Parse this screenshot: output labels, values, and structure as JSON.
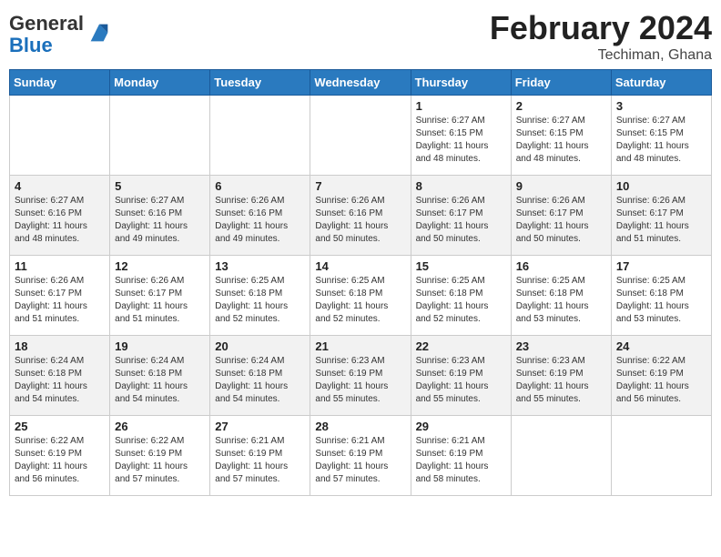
{
  "header": {
    "logo_general": "General",
    "logo_blue": "Blue",
    "title": "February 2024",
    "subtitle": "Techiman, Ghana"
  },
  "days_of_week": [
    "Sunday",
    "Monday",
    "Tuesday",
    "Wednesday",
    "Thursday",
    "Friday",
    "Saturday"
  ],
  "weeks": [
    [
      {
        "day": "",
        "info": ""
      },
      {
        "day": "",
        "info": ""
      },
      {
        "day": "",
        "info": ""
      },
      {
        "day": "",
        "info": ""
      },
      {
        "day": "1",
        "info": "Sunrise: 6:27 AM\nSunset: 6:15 PM\nDaylight: 11 hours and 48 minutes."
      },
      {
        "day": "2",
        "info": "Sunrise: 6:27 AM\nSunset: 6:15 PM\nDaylight: 11 hours and 48 minutes."
      },
      {
        "day": "3",
        "info": "Sunrise: 6:27 AM\nSunset: 6:15 PM\nDaylight: 11 hours and 48 minutes."
      }
    ],
    [
      {
        "day": "4",
        "info": "Sunrise: 6:27 AM\nSunset: 6:16 PM\nDaylight: 11 hours and 48 minutes."
      },
      {
        "day": "5",
        "info": "Sunrise: 6:27 AM\nSunset: 6:16 PM\nDaylight: 11 hours and 49 minutes."
      },
      {
        "day": "6",
        "info": "Sunrise: 6:26 AM\nSunset: 6:16 PM\nDaylight: 11 hours and 49 minutes."
      },
      {
        "day": "7",
        "info": "Sunrise: 6:26 AM\nSunset: 6:16 PM\nDaylight: 11 hours and 50 minutes."
      },
      {
        "day": "8",
        "info": "Sunrise: 6:26 AM\nSunset: 6:17 PM\nDaylight: 11 hours and 50 minutes."
      },
      {
        "day": "9",
        "info": "Sunrise: 6:26 AM\nSunset: 6:17 PM\nDaylight: 11 hours and 50 minutes."
      },
      {
        "day": "10",
        "info": "Sunrise: 6:26 AM\nSunset: 6:17 PM\nDaylight: 11 hours and 51 minutes."
      }
    ],
    [
      {
        "day": "11",
        "info": "Sunrise: 6:26 AM\nSunset: 6:17 PM\nDaylight: 11 hours and 51 minutes."
      },
      {
        "day": "12",
        "info": "Sunrise: 6:26 AM\nSunset: 6:17 PM\nDaylight: 11 hours and 51 minutes."
      },
      {
        "day": "13",
        "info": "Sunrise: 6:25 AM\nSunset: 6:18 PM\nDaylight: 11 hours and 52 minutes."
      },
      {
        "day": "14",
        "info": "Sunrise: 6:25 AM\nSunset: 6:18 PM\nDaylight: 11 hours and 52 minutes."
      },
      {
        "day": "15",
        "info": "Sunrise: 6:25 AM\nSunset: 6:18 PM\nDaylight: 11 hours and 52 minutes."
      },
      {
        "day": "16",
        "info": "Sunrise: 6:25 AM\nSunset: 6:18 PM\nDaylight: 11 hours and 53 minutes."
      },
      {
        "day": "17",
        "info": "Sunrise: 6:25 AM\nSunset: 6:18 PM\nDaylight: 11 hours and 53 minutes."
      }
    ],
    [
      {
        "day": "18",
        "info": "Sunrise: 6:24 AM\nSunset: 6:18 PM\nDaylight: 11 hours and 54 minutes."
      },
      {
        "day": "19",
        "info": "Sunrise: 6:24 AM\nSunset: 6:18 PM\nDaylight: 11 hours and 54 minutes."
      },
      {
        "day": "20",
        "info": "Sunrise: 6:24 AM\nSunset: 6:18 PM\nDaylight: 11 hours and 54 minutes."
      },
      {
        "day": "21",
        "info": "Sunrise: 6:23 AM\nSunset: 6:19 PM\nDaylight: 11 hours and 55 minutes."
      },
      {
        "day": "22",
        "info": "Sunrise: 6:23 AM\nSunset: 6:19 PM\nDaylight: 11 hours and 55 minutes."
      },
      {
        "day": "23",
        "info": "Sunrise: 6:23 AM\nSunset: 6:19 PM\nDaylight: 11 hours and 55 minutes."
      },
      {
        "day": "24",
        "info": "Sunrise: 6:22 AM\nSunset: 6:19 PM\nDaylight: 11 hours and 56 minutes."
      }
    ],
    [
      {
        "day": "25",
        "info": "Sunrise: 6:22 AM\nSunset: 6:19 PM\nDaylight: 11 hours and 56 minutes."
      },
      {
        "day": "26",
        "info": "Sunrise: 6:22 AM\nSunset: 6:19 PM\nDaylight: 11 hours and 57 minutes."
      },
      {
        "day": "27",
        "info": "Sunrise: 6:21 AM\nSunset: 6:19 PM\nDaylight: 11 hours and 57 minutes."
      },
      {
        "day": "28",
        "info": "Sunrise: 6:21 AM\nSunset: 6:19 PM\nDaylight: 11 hours and 57 minutes."
      },
      {
        "day": "29",
        "info": "Sunrise: 6:21 AM\nSunset: 6:19 PM\nDaylight: 11 hours and 58 minutes."
      },
      {
        "day": "",
        "info": ""
      },
      {
        "day": "",
        "info": ""
      }
    ]
  ]
}
